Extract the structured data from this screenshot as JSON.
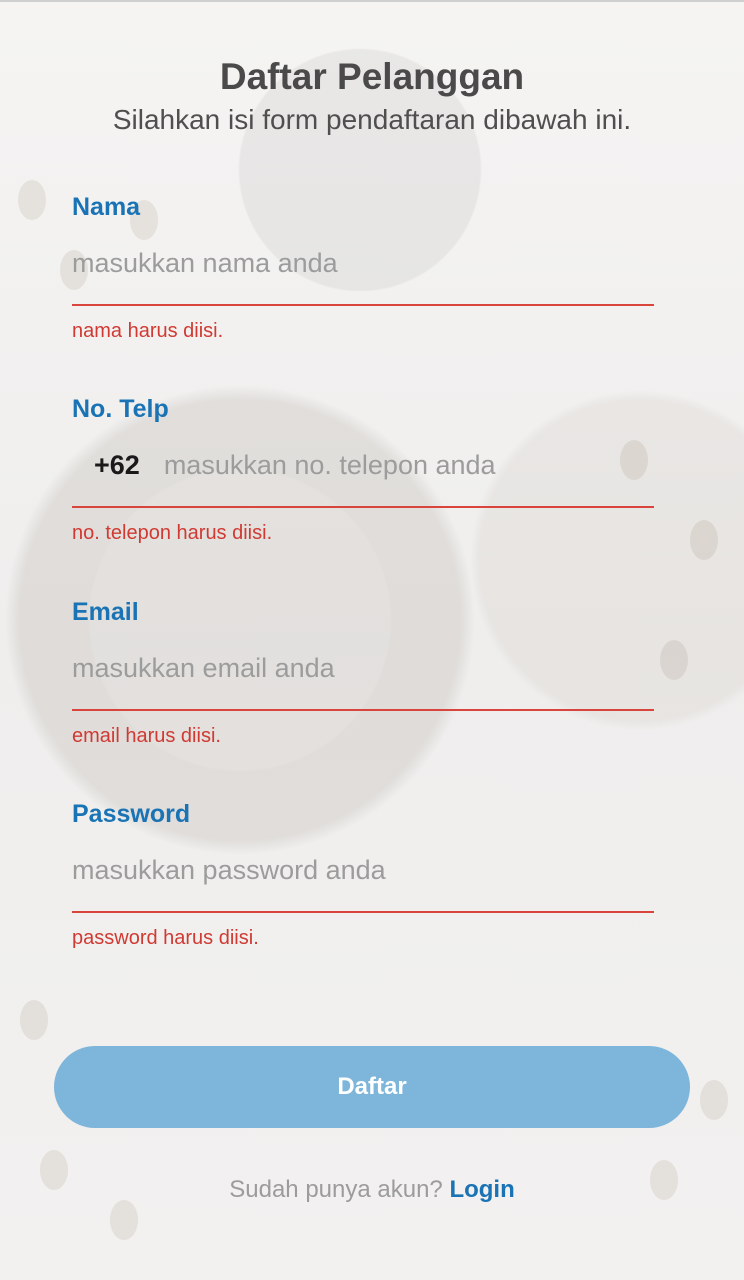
{
  "header": {
    "title": "Daftar Pelanggan",
    "subtitle": "Silahkan isi form pendaftaran dibawah ini."
  },
  "form": {
    "nama": {
      "label": "Nama",
      "placeholder": "masukkan nama anda",
      "value": "",
      "error": "nama harus diisi."
    },
    "telp": {
      "label": "No. Telp",
      "prefix": "+62",
      "placeholder": "masukkan no. telepon anda",
      "value": "",
      "error": "no. telepon harus diisi."
    },
    "email": {
      "label": "Email",
      "placeholder": "masukkan email anda",
      "value": "",
      "error": "email harus diisi."
    },
    "password": {
      "label": "Password",
      "placeholder": "masukkan password anda",
      "value": "",
      "error": "password harus diisi."
    }
  },
  "submit_label": "Daftar",
  "footer": {
    "prompt": "Sudah punya akun?",
    "login_label": "Login"
  },
  "colors": {
    "accent": "#1a73b5",
    "error": "#d03a32",
    "button": "#7eb5da"
  }
}
